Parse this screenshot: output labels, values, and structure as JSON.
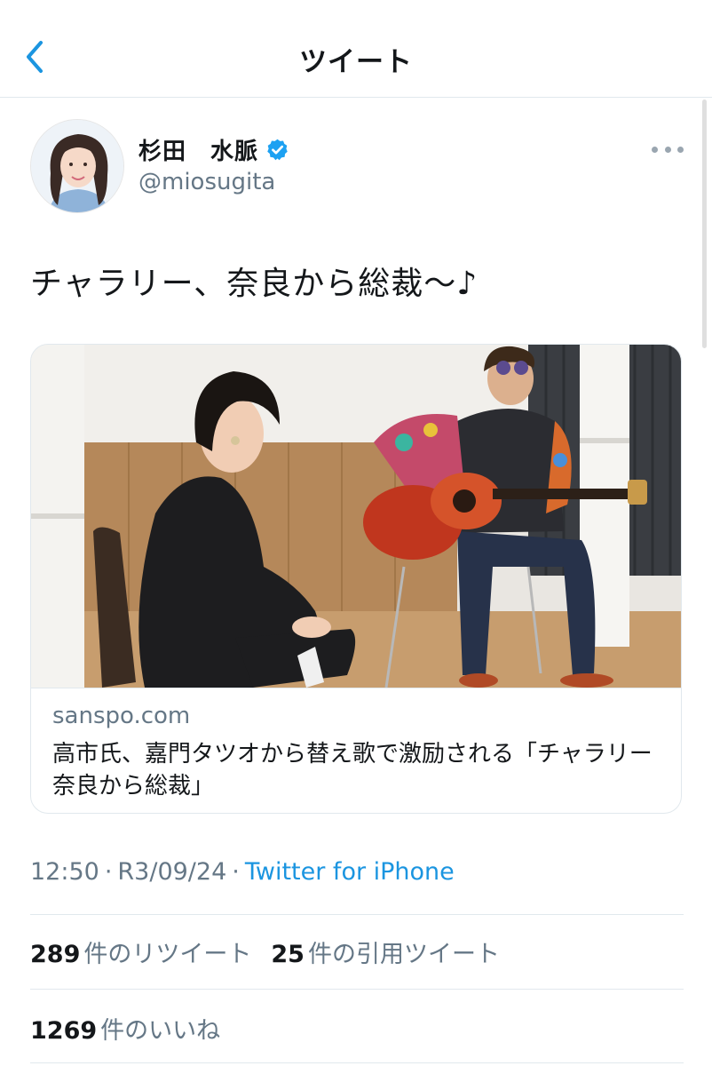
{
  "header": {
    "title": "ツイート",
    "back_icon": "chevron-left-icon",
    "accent_color": "#1b95e0"
  },
  "tweet": {
    "author": {
      "name": "杉田　水脈",
      "handle": "@miosugita",
      "verified": true,
      "verified_color": "#1da1f2"
    },
    "text": "チャラリー、奈良から総裁〜♪",
    "link_card": {
      "domain": "sanspo.com",
      "title": "高市氏、嘉門タツオから替え歌で激励される「チャラリー奈良から総裁」"
    },
    "meta": {
      "time": "12:50",
      "date": "R3/09/24",
      "source": "Twitter for iPhone",
      "separator": "·"
    },
    "stats": {
      "retweets_count": "289",
      "retweets_label": "件のリツイート",
      "quotes_count": "25",
      "quotes_label": "件の引用ツイート",
      "likes_count": "1269",
      "likes_label": "件のいいね"
    }
  }
}
